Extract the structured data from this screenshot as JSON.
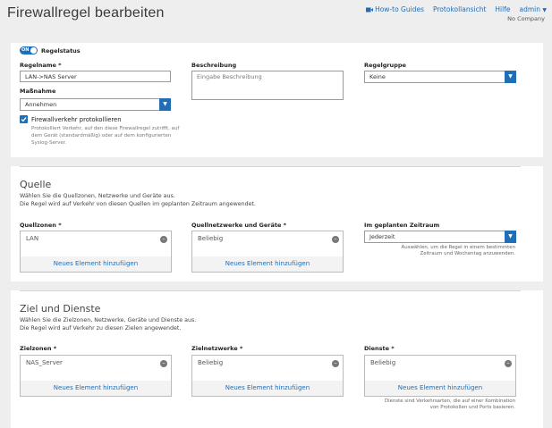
{
  "header": {
    "title": "Firewallregel bearbeiten",
    "links": {
      "howto": "How-to Guides",
      "log": "Protokollansicht",
      "help": "Hilfe",
      "admin": "admin"
    },
    "company": "No Company"
  },
  "rule": {
    "status_toggle": "ON",
    "status_label": "Regelstatus",
    "name_label": "Regelname *",
    "name_value": "LAN->NAS Server",
    "description_label": "Beschreibung",
    "description_placeholder": "Eingabe Beschreibung",
    "group_label": "Regelgruppe",
    "group_value": "Keine",
    "action_label": "Maßnahme",
    "action_value": "Annehmen",
    "log_label": "Firewallverkehr protokollieren",
    "log_hint_1": "Protokolliert Verkehr, auf den diese Firewallregel zutrifft, auf",
    "log_hint_2": "dem Gerät (standardmäßig) oder auf dem konfigurierten",
    "log_hint_3": "Syslog-Server."
  },
  "source": {
    "title": "Quelle",
    "desc_1": "Wählen Sie die Quellzonen, Netzwerke und Geräte aus.",
    "desc_2": "Die Regel wird auf Verkehr von diesen Quellen im geplanten Zeitraum angewendet.",
    "zones_label": "Quellzonen *",
    "zones_item": "LAN",
    "networks_label": "Quellnetzwerke und Geräte *",
    "networks_item": "Beliebig",
    "schedule_label": "Im geplanten Zeitraum",
    "schedule_value": "Jederzeit",
    "schedule_hint_1": "Auswählen, um die Regel in einem bestimmten",
    "schedule_hint_2": "Zeitraum und Wochentag anzuwenden.",
    "add_label": "Neues Element hinzufügen"
  },
  "dest": {
    "title": "Ziel und Dienste",
    "desc_1": "Wählen Sie die Zielzonen, Netzwerke, Geräte und Dienste aus.",
    "desc_2": "Die Regel wird auf Verkehr zu diesen Zielen angewendet.",
    "zones_label": "Zielzonen *",
    "zones_item": "NAS_Server",
    "networks_label": "Zielnetzwerke *",
    "networks_item": "Beliebig",
    "services_label": "Dienste *",
    "services_item": "Beliebig",
    "services_hint_1": "Dienste sind Verkehrsarten, die auf einer Kombination",
    "services_hint_2": "von Protokollen und Ports basieren.",
    "add_label": "Neues Element hinzufügen"
  },
  "colors": {
    "accent": "#1f6eb6",
    "background": "#eeeeee",
    "card": "#ffffff"
  },
  "icons": {
    "video": "video-camera-icon",
    "caret": "chevron-down-icon",
    "remove": "minus-circle-icon",
    "check": "checkbox-checked-icon"
  }
}
